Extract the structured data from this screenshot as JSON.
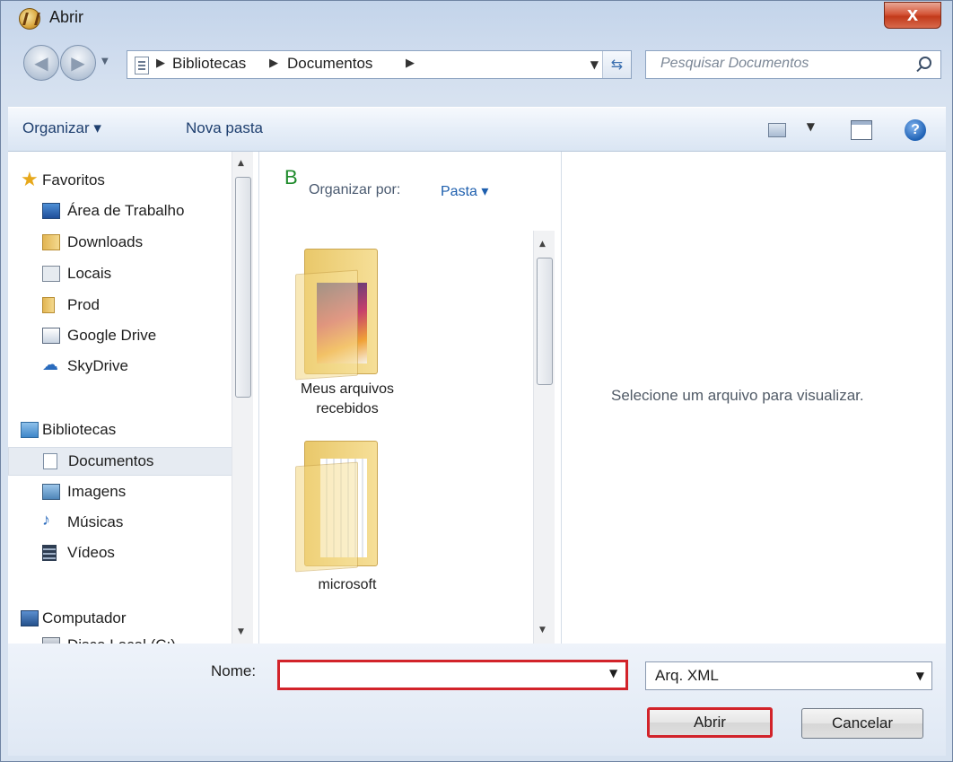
{
  "window": {
    "title": "Abrir",
    "close_label": "x"
  },
  "address": {
    "crumbs": [
      "Bibliotecas",
      "Documentos"
    ],
    "search_placeholder": "Pesquisar Documentos"
  },
  "toolbar": {
    "organize": "Organizar ▾",
    "new_folder": "Nova pasta"
  },
  "nav_pane": {
    "favorites": [
      "Favoritos",
      "Área de Trabalho",
      "Downloads",
      "Locais",
      "Prod",
      "Google Drive",
      "SkyDrive"
    ],
    "libraries": [
      "Bibliotecas",
      "Documentos",
      "Imagens",
      "Músicas",
      "Vídeos"
    ],
    "computer": [
      "Computador",
      "Disco Local (C:)"
    ],
    "selected": "Documentos"
  },
  "file_pane": {
    "library_letter": "B",
    "arrange_label": "Organizar por:",
    "arrange_value": "Pasta ▾",
    "items": [
      {
        "line1": "Meus arquivos",
        "line2": "recebidos"
      },
      {
        "line1": "microsoft",
        "line2": ""
      }
    ]
  },
  "preview": {
    "message": "Selecione um arquivo para visualizar."
  },
  "footer": {
    "name_label": "Nome:",
    "name_value": "",
    "file_type": "Arq. XML",
    "open_button": "Abrir",
    "cancel_button": "Cancelar"
  }
}
